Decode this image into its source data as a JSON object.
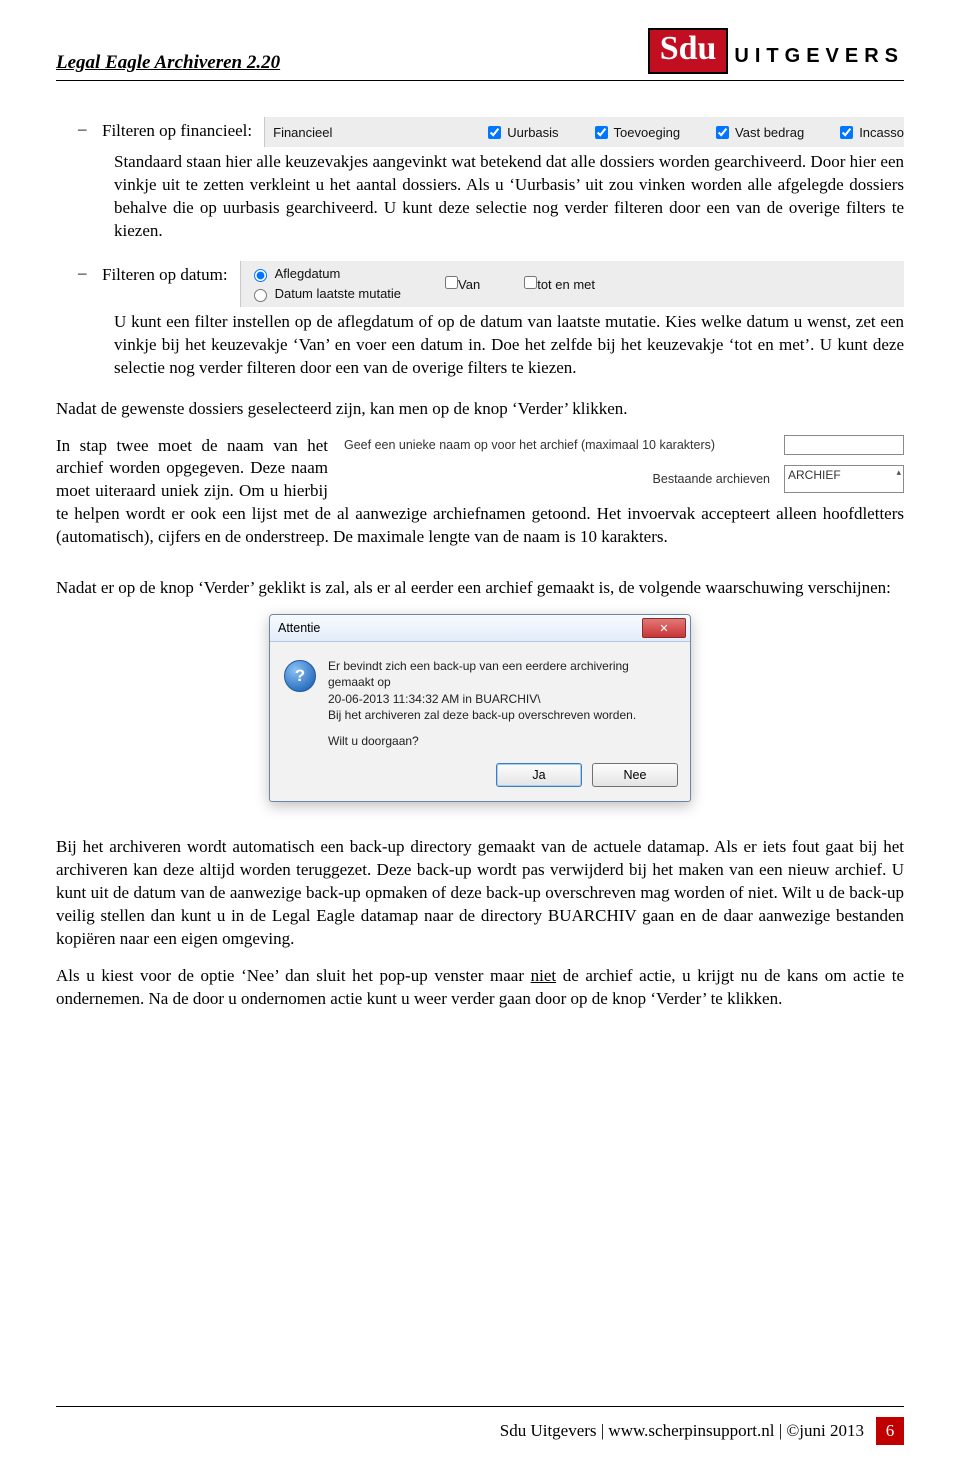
{
  "header": {
    "doc_title": "Legal Eagle Archiveren 2.20",
    "logo_brand": "Sdu",
    "logo_suffix": "UITGEVERS"
  },
  "financieel": {
    "bullet_label": "Filteren op financieel:",
    "strip_label": "Financieel",
    "cb1": "Uurbasis",
    "cb2": "Toevoeging",
    "cb3": "Vast bedrag",
    "cb4": "Incasso",
    "body": "Standaard staan hier alle keuzevakjes aangevinkt wat betekend dat alle dossiers worden gearchiveerd. Door hier een vinkje uit te zetten verkleint u het aantal dossiers. Als u ‘Uurbasis’ uit zou vinken worden alle afgelegde dossiers behalve die op uurbasis gearchiveerd. U kunt deze selectie nog verder filteren door een van de overige filters te kiezen."
  },
  "datum": {
    "bullet_label": "Filteren op datum:",
    "radio1": "Aflegdatum",
    "radio2": "Datum laatste mutatie",
    "cb_van": "Van",
    "cb_tot": "tot en met",
    "body": "U kunt een filter instellen op de aflegdatum of op de datum van laatste mutatie. Kies welke datum u wenst, zet een vinkje bij het keuzevakje ‘Van’ en voer een datum in. Doe het zelfde bij het keuzevakje ‘tot en met’. U kunt deze selectie nog verder filteren door een van de overige filters te kiezen."
  },
  "para_after": "Nadat de gewenste dossiers geselecteerd zijn, kan men op de knop ‘Verder’ klikken.",
  "step2": {
    "lead_before": "In stap twee moet de naam van het archief worden opgegeven. Deze naam moet uiteraard uniek zijn. Om u hierbij te helpen wordt er ook een lijst met de al aanwezige archiefnamen getoond. Het invoervak accepteert alleen hoofdletters (automatisch), cijfers en de onderstreep. De maximale lengte van de naam is 10 karakters.",
    "fig_label1": "Geef een unieke naam op voor het archief (maximaal 10 karakters)",
    "fig_label2": "Bestaande archieven",
    "fig_value2": "ARCHIEF"
  },
  "warn_intro": "Nadat er op de knop ‘Verder’ geklikt is zal, als er al eerder een archief gemaakt is, de volgende waarschuwing verschijnen:",
  "dialog": {
    "title": "Attentie",
    "line1": "Er bevindt zich een back-up van een eerdere archivering gemaakt op",
    "line2": "20-06-2013 11:34:32 AM in BUARCHIV\\",
    "line3": "Bij het archiveren zal deze back-up overschreven worden.",
    "line4": "Wilt u doorgaan?",
    "btn_yes": "Ja",
    "btn_no": "Nee"
  },
  "para_backup": "Bij het archiveren wordt automatisch een back-up directory gemaakt van de actuele datamap. Als er iets fout gaat bij het archiveren kan deze altijd worden teruggezet. Deze back-up wordt pas verwijderd bij het maken van een nieuw archief. U kunt uit de datum van de aanwezige back-up opmaken of deze back-up overschreven mag worden of niet. Wilt u de back-up veilig stellen dan kunt u in de Legal Eagle datamap naar de directory BUARCHIV gaan en de daar aanwezige bestanden kopiëren naar een eigen omgeving.",
  "para_nee_pre": "Als u kiest voor de optie ‘Nee’ dan sluit het pop-up venster maar ",
  "para_nee_u": "niet",
  "para_nee_post": " de archief actie, u krijgt nu de kans om actie te ondernemen. Na de door u ondernomen actie kunt u weer verder gaan door op de knop ‘Verder’ te klikken.",
  "footer": {
    "text": "Sdu Uitgevers | www.scherpinsupport.nl | ©juni 2013",
    "page": "6"
  }
}
